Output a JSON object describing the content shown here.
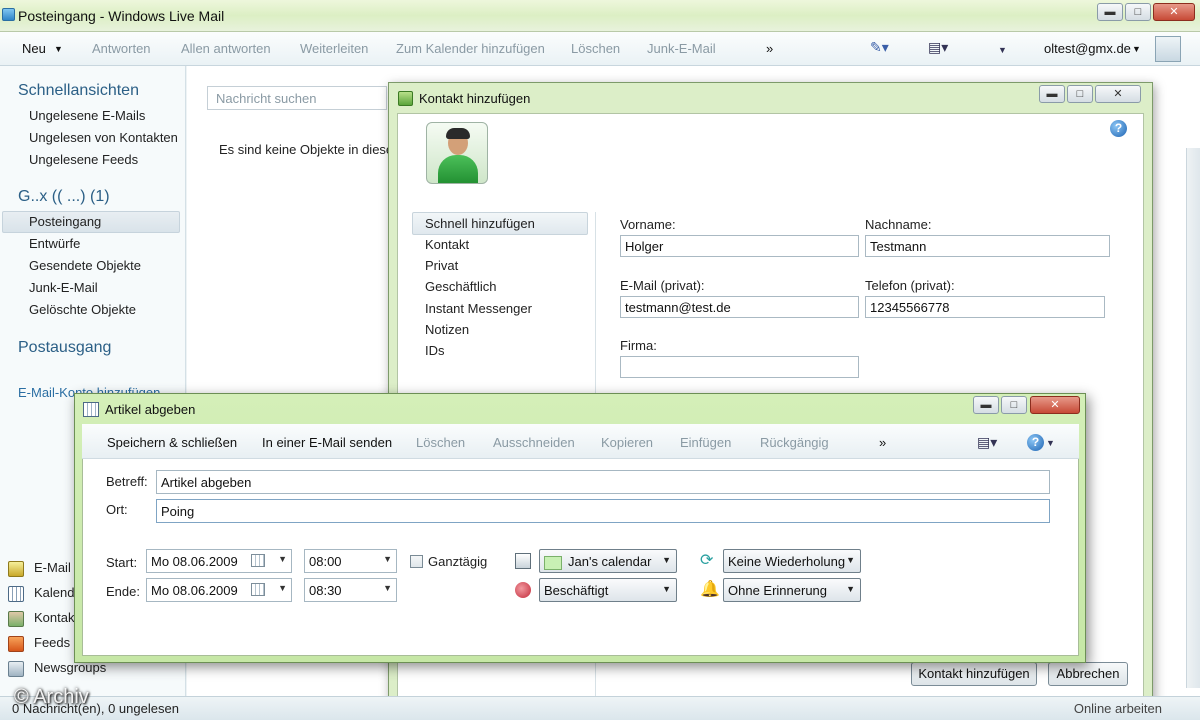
{
  "window": {
    "title": "Posteingang - Windows Live Mail",
    "btn_min": "▬",
    "btn_max": "□",
    "btn_close": "✕"
  },
  "toolbar": {
    "new": "Neu",
    "reply": "Antworten",
    "reply_all": "Allen antworten",
    "forward": "Weiterleiten",
    "add_calendar": "Zum Kalender hinzufügen",
    "delete": "Löschen",
    "junk": "Junk-E-Mail",
    "more": "»",
    "account": "oltest@gmx.de"
  },
  "nav": {
    "quick_views_title": "Schnellansichten",
    "quick_views": [
      "Ungelesene E-Mails",
      "Ungelesen von Kontakten",
      "Ungelesene Feeds"
    ],
    "account_title": "G..x (( ...) (1)",
    "folders": [
      "Posteingang",
      "Entwürfe",
      "Gesendete Objekte",
      "Junk-E-Mail",
      "Gelöschte Objekte"
    ],
    "outbox": "Postausgang",
    "add_account": "E-Mail-Konto hinzufügen",
    "modules": [
      "E-Mail",
      "Kalender",
      "Kontakte",
      "Feeds",
      "Newsgroups"
    ]
  },
  "center": {
    "search_placeholder": "Nachricht suchen",
    "empty_message": "Es sind keine Objekte in dieser"
  },
  "status": {
    "left": "0 Nachricht(en), 0 ungelesen",
    "right": "Online arbeiten",
    "watermark": "© Archiv"
  },
  "contact_dialog": {
    "title": "Kontakt hinzufügen",
    "categories": [
      "Schnell hinzufügen",
      "Kontakt",
      "Privat",
      "Geschäftlich",
      "Instant Messenger",
      "Notizen",
      "IDs"
    ],
    "first_name_label": "Vorname:",
    "first_name": "Holger",
    "last_name_label": "Nachname:",
    "last_name": "Testmann",
    "email_label": "E-Mail (privat):",
    "email": "testmann@test.de",
    "phone_label": "Telefon (privat):",
    "phone": "12345566778",
    "company_label": "Firma:",
    "company": "",
    "add_button": "Kontakt hinzufügen",
    "cancel_button": "Abbrechen"
  },
  "event_dialog": {
    "title": "Artikel abgeben",
    "toolbar": {
      "save_close": "Speichern & schließen",
      "send_email": "In einer E-Mail senden",
      "delete": "Löschen",
      "cut": "Ausschneiden",
      "copy": "Kopieren",
      "paste": "Einfügen",
      "undo": "Rückgängig",
      "more": "»"
    },
    "subject_label": "Betreff:",
    "subject": "Artikel abgeben",
    "location_label": "Ort:",
    "location": "Poing",
    "start_label": "Start:",
    "start_date": "Mo 08.06.2009",
    "start_time": "08:00",
    "end_label": "Ende:",
    "end_date": "Mo 08.06.2009",
    "end_time": "08:30",
    "all_day_label": "Ganztägig",
    "calendar": "Jan's calendar",
    "busy": "Beschäftigt",
    "recurrence": "Keine Wiederholung",
    "reminder": "Ohne Erinnerung"
  }
}
